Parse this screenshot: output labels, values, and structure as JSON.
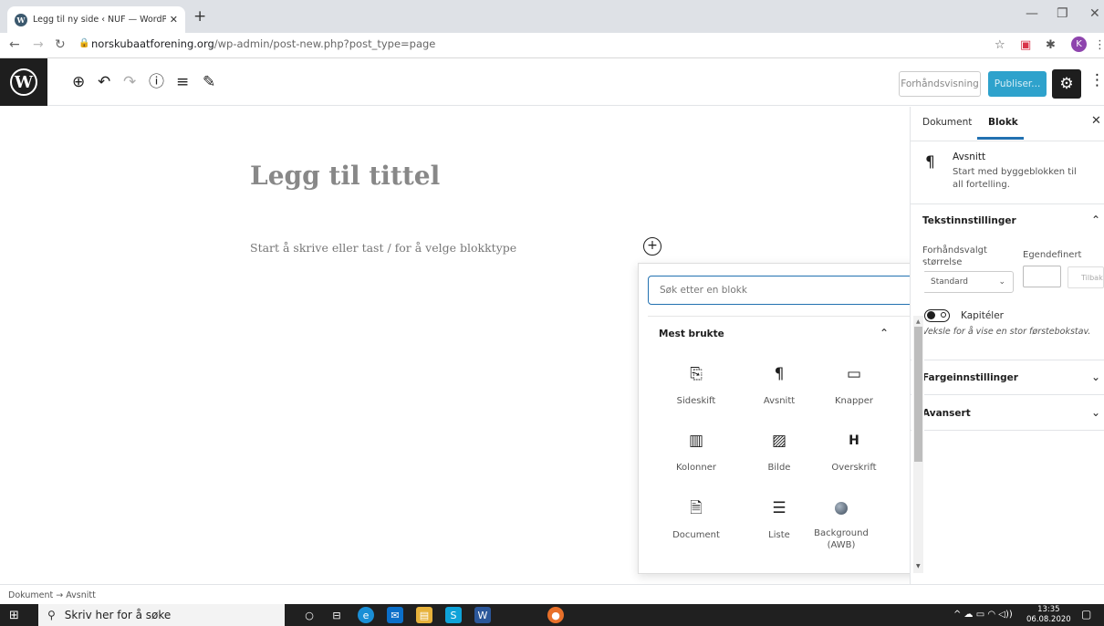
{
  "browser": {
    "tab_title": "Legg til ny side ‹ NUF — WordPr",
    "url_domain": "norskubaatforening.org",
    "url_path": "/wp-admin/post-new.php?post_type=page",
    "profile_initial": "K"
  },
  "toolbar": {
    "preview_label": "Forhåndsvisning",
    "publish_label": "Publiser..."
  },
  "editor": {
    "title_placeholder": "Legg til tittel",
    "body_placeholder": "Start å skrive eller tast / for å velge blokktype"
  },
  "inserter": {
    "search_placeholder": "Søk etter en blokk",
    "section_title": "Mest brukte",
    "blocks": [
      {
        "label": "Sideskift",
        "icon": "page-break-icon"
      },
      {
        "label": "Avsnitt",
        "icon": "paragraph-icon"
      },
      {
        "label": "Knapper",
        "icon": "buttons-icon"
      },
      {
        "label": "Kolonner",
        "icon": "columns-icon"
      },
      {
        "label": "Bilde",
        "icon": "image-icon"
      },
      {
        "label": "Overskrift",
        "icon": "heading-icon"
      },
      {
        "label": "Document",
        "icon": "document-icon"
      },
      {
        "label": "Liste",
        "icon": "list-icon"
      },
      {
        "label": "Background (AWB)",
        "icon": "awb-icon"
      }
    ]
  },
  "sidebar": {
    "tab_document": "Dokument",
    "tab_block": "Blokk",
    "block_name": "Avsnitt",
    "block_description": "Start med byggeblokken til all fortelling.",
    "text_settings_title": "Tekstinnstillinger",
    "preset_size_label": "Forhåndsvalgt størrelse",
    "custom_label": "Egendefinert",
    "preset_value": "Standard",
    "reset_label": "Tilbak",
    "dropcap_label": "Kapitéler",
    "dropcap_help": "Veksle for å vise en stor førstebokstav.",
    "color_settings_title": "Fargeinnstillinger",
    "advanced_title": "Avansert"
  },
  "breadcrumb": {
    "text": "Dokument → Avsnitt"
  },
  "taskbar": {
    "search_placeholder": "Skriv her for å søke",
    "time": "13:35",
    "date": "06.08.2020"
  },
  "colors": {
    "accent": "#2271b1",
    "publish": "#2ea2cc",
    "wp_dark": "#1e1e1e"
  }
}
